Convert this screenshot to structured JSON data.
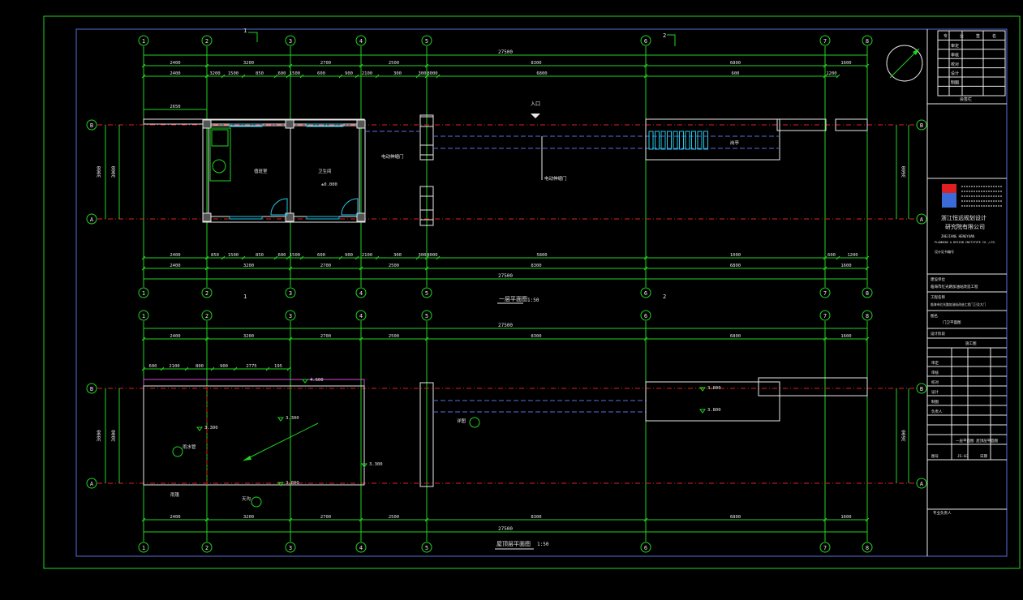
{
  "axes": {
    "numbers": [
      "1",
      "2",
      "3",
      "4",
      "5",
      "6",
      "7",
      "8"
    ],
    "rows": [
      "B",
      "A"
    ]
  },
  "dims": {
    "total": "27500",
    "top_row": [
      "2400",
      "3200",
      "2700",
      "2500",
      "8300",
      "6800",
      "1600"
    ],
    "detail_row_upper": [
      "2400",
      "3200",
      "1500",
      "850",
      "600",
      "1500",
      "600",
      "900",
      "2100",
      "300",
      "300",
      "8000",
      "6800",
      "600",
      "1200"
    ],
    "detail_row_lower": [
      "2400",
      "850",
      "1500",
      "850",
      "600",
      "1500",
      "600",
      "900",
      "2100",
      "300",
      "300",
      "8000",
      "5800",
      "1000",
      "600",
      "1200"
    ],
    "depth": "3000",
    "depth_right": "3600",
    "left_overhang": "2650",
    "roof_row": [
      "600",
      "2100",
      "800",
      "900",
      "2775",
      "195"
    ]
  },
  "plan1": {
    "title": "一层平面图",
    "scale": "1:50",
    "section_marks": [
      "1",
      "2"
    ],
    "room_labels": [
      "值班室",
      "卫生间"
    ],
    "elevation": "±0.000",
    "entry": "入口",
    "notes": [
      "电动伸缩门",
      "电动伸缩门",
      "岗亭"
    ]
  },
  "plan2": {
    "title": "屋顶层平面图",
    "scale": "1:50",
    "elevations": [
      "4.600",
      "3.300",
      "3.300",
      "3.300",
      "3.800",
      "3.800",
      "3.800"
    ],
    "notes": [
      "雨水管",
      "天沟",
      "详图",
      "雨篷"
    ]
  },
  "title_block": {
    "sign_headers": [
      "专",
      "业",
      "签",
      "名"
    ],
    "sign_rows": [
      "审定",
      "审核",
      "校对",
      "设计",
      "制图"
    ],
    "sign_label": "会签栏",
    "company_cn": "浙江恒远规划设计",
    "company_cn2": "研究院有限公司",
    "company_en": "ZHEJIANG HENGYUAN",
    "company_en2": "PLANNING & DESIGN INSTITUTE CO.,LTD.",
    "cert": "设计证书编号",
    "project_label": "建设单位",
    "project": "临海市红光路加油站改造工程",
    "subproject_label": "工程名称",
    "subproject": "临海市红光路加油站改造工程门卫及大门",
    "drawing_label": "图名",
    "drawing": "门卫平面图",
    "stage_label": "设计阶段",
    "stage": "施工图",
    "rows": [
      "审定",
      "审核",
      "校对",
      "设计",
      "制图",
      "负责人"
    ],
    "drawing_name": "一层平面图\n屋顶层平面图",
    "sheet_label": "图号",
    "sheet": "JS-03",
    "date_label": "日期",
    "note": "专业负责人"
  },
  "colors": {
    "grid": "#22d422",
    "axis": "#e02020",
    "wall": "#e8e8e8",
    "accent": "#22c8e8"
  }
}
